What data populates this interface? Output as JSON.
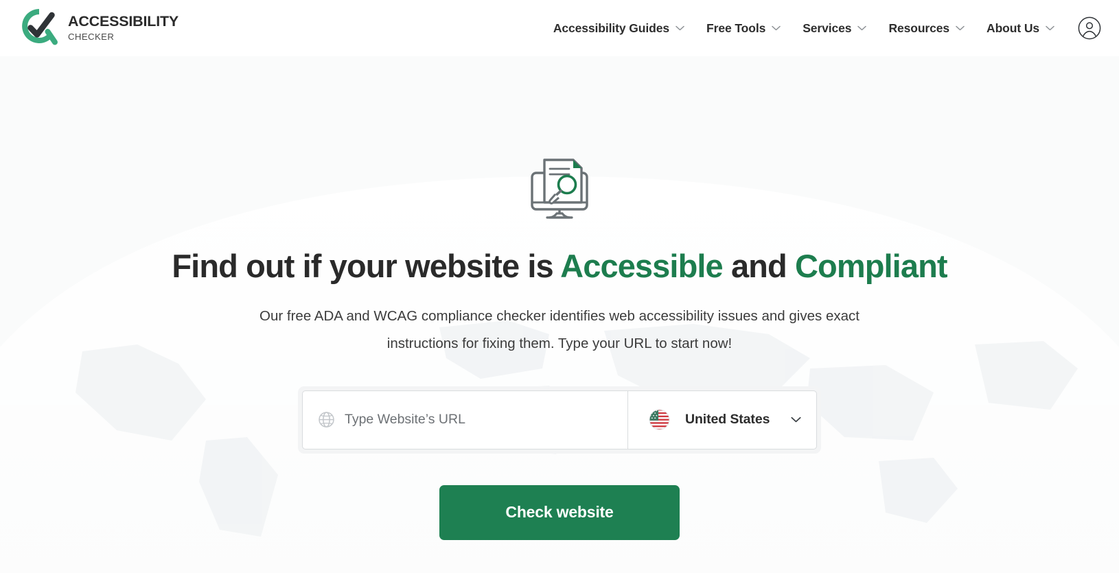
{
  "header": {
    "brand": {
      "title": "ACCESSIBILITY",
      "subtitle": "CHECKER",
      "logo_icon": "accessibility-check-logo-icon",
      "mark_color": "#3bab7f",
      "check_color": "#2f3337"
    },
    "nav": [
      {
        "label": "Accessibility Guides",
        "has_dropdown": true,
        "icon": "chevron-down-icon"
      },
      {
        "label": "Free Tools",
        "has_dropdown": true,
        "icon": "chevron-down-icon"
      },
      {
        "label": "Services",
        "has_dropdown": true,
        "icon": "chevron-down-icon"
      },
      {
        "label": "Resources",
        "has_dropdown": true,
        "icon": "chevron-down-icon"
      },
      {
        "label": "About Us",
        "has_dropdown": true,
        "icon": "chevron-down-icon"
      }
    ],
    "account": {
      "icon": "user-account-circle-icon",
      "label": "Account"
    }
  },
  "hero": {
    "illustration_icon": "monitor-document-magnifier-icon",
    "headline": {
      "part1": "Find out if your website is ",
      "highlight1": "Accessible",
      "part2": " and ",
      "highlight2": "Compliant",
      "highlight_color": "#1d7d4e"
    },
    "subheadline": "Our free ADA and WCAG compliance checker identifies web accessibility issues and gives exact instructions for fixing them. Type your URL to start now!",
    "search": {
      "url_icon": "globe-icon",
      "url_value": "",
      "url_placeholder": "Type Website’s URL",
      "country": {
        "flag_icon": "us-flag-icon",
        "selected": "United States",
        "chevron_icon": "chevron-down-icon"
      }
    },
    "cta_label": "Check website",
    "cta_color": "#1e8052"
  }
}
